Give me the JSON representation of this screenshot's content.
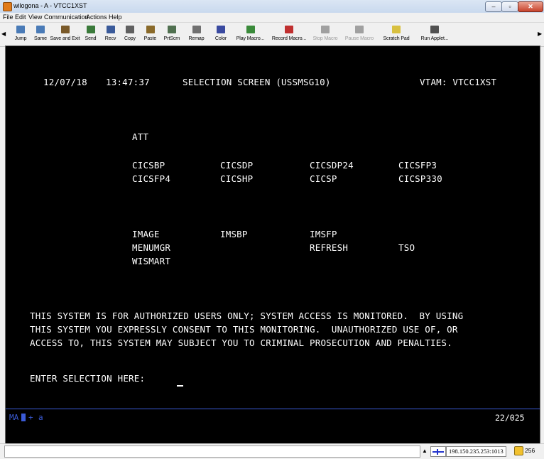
{
  "window": {
    "title": "wilogona - A - VTCC1XST"
  },
  "menu": [
    "File",
    "Edit",
    "View",
    "Communication",
    "Actions",
    "Help"
  ],
  "toolbar": {
    "buttons": [
      {
        "label": "Jump",
        "icon": "jump-icon",
        "color": "#4a7bb7",
        "enabled": true
      },
      {
        "label": "Same",
        "icon": "same-icon",
        "color": "#4a7bb7",
        "enabled": true
      },
      {
        "label": "Save and Exit",
        "icon": "save-exit-icon",
        "color": "#7a5a2a",
        "enabled": true
      },
      {
        "label": "Send",
        "icon": "send-icon",
        "color": "#3a7a3a",
        "enabled": true
      },
      {
        "label": "Recv",
        "icon": "recv-icon",
        "color": "#3a5a9a",
        "enabled": true
      },
      {
        "label": "Copy",
        "icon": "copy-icon",
        "color": "#606060",
        "enabled": true
      },
      {
        "label": "Paste",
        "icon": "paste-icon",
        "color": "#8a6a2a",
        "enabled": true
      },
      {
        "label": "PrtScrn",
        "icon": "printer-icon",
        "color": "#507050",
        "enabled": true
      },
      {
        "label": "Remap",
        "icon": "remap-icon",
        "color": "#707070",
        "enabled": true
      },
      {
        "label": "Color",
        "icon": "color-icon",
        "color": "#3a4aa0",
        "enabled": true
      },
      {
        "label": "Play Macro...",
        "icon": "play-macro-icon",
        "color": "#3a8a3a",
        "enabled": true
      },
      {
        "label": "Record Macro...",
        "icon": "record-macro-icon",
        "color": "#c03030",
        "enabled": true
      },
      {
        "label": "Stop Macro",
        "icon": "stop-macro-icon",
        "color": "#a0a0a0",
        "enabled": false
      },
      {
        "label": "Pause Macro",
        "icon": "pause-macro-icon",
        "color": "#a0a0a0",
        "enabled": false
      },
      {
        "label": "Scratch Pad",
        "icon": "scratch-pad-icon",
        "color": "#d8c040",
        "enabled": true
      },
      {
        "label": "Run Applet...",
        "icon": "run-applet-icon",
        "color": "#505050",
        "enabled": true
      }
    ]
  },
  "screen": {
    "date": "12/07/18",
    "time": "13:47:37",
    "heading": "SELECTION SCREEN (USSMSG10)",
    "vtam": "VTAM: VTCC1XST",
    "selections": {
      "att": "ATT",
      "row1": [
        "CICSBP",
        "CICSDP",
        "CICSDP24",
        "CICSFP3"
      ],
      "row2": [
        "CICSFP4",
        "CICSHP",
        "CICSP",
        "CICSP330"
      ],
      "row3": [
        "IMAGE",
        "IMSBP",
        "IMSFP"
      ],
      "row4": [
        "MENUMGR",
        "REFRESH",
        "TSO"
      ],
      "row5": [
        "WISMART"
      ]
    },
    "warning": [
      "THIS SYSTEM IS FOR AUTHORIZED USERS ONLY; SYSTEM ACCESS IS MONITORED.  BY USING",
      "THIS SYSTEM YOU EXPRESSLY CONSENT TO THIS MONITORING.  UNAUTHORIZED USE OF, OR",
      "ACCESS TO, THIS SYSTEM MAY SUBJECT YOU TO CRIMINAL PROSECUTION AND PENALTIES."
    ],
    "prompt": "ENTER SELECTION HERE:",
    "oia": {
      "ma": "MA",
      "plus": "+",
      "mode": "a",
      "cursor_pos": "22/025"
    }
  },
  "status": {
    "host": "198.150.235.253:1013",
    "sessions": "256"
  },
  "colors": {
    "terminal_bg": "#000000",
    "terminal_text": "#ffffff",
    "oia_accent": "#3b5bd6"
  }
}
